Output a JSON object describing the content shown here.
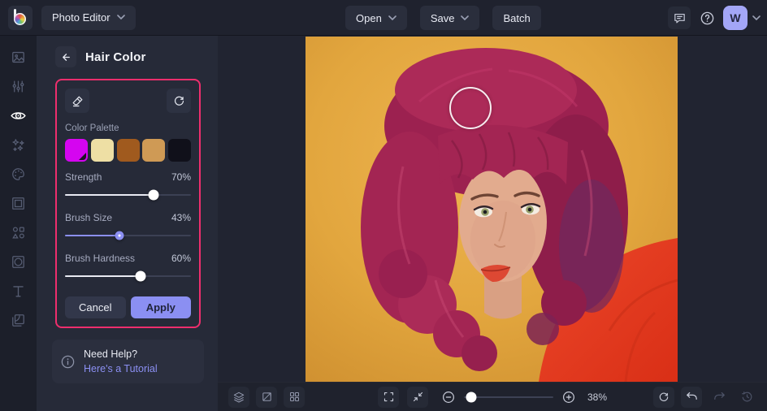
{
  "topbar": {
    "app_menu_label": "Photo Editor",
    "open_label": "Open",
    "save_label": "Save",
    "batch_label": "Batch",
    "avatar_initial": "W"
  },
  "rail": {
    "items": [
      "image-editor",
      "adjust",
      "touch-up",
      "effects",
      "artsy",
      "frames",
      "graphics",
      "overlays",
      "text",
      "textures"
    ],
    "active_item": "touch-up"
  },
  "panel": {
    "title": "Hair Color",
    "palette_label": "Color Palette",
    "swatches": [
      {
        "color": "#d505f0",
        "custom": true
      },
      {
        "color": "#eedfa4",
        "custom": false
      },
      {
        "color": "#a05a1e",
        "custom": false
      },
      {
        "color": "#cf9a55",
        "custom": false
      },
      {
        "color": "#10101a",
        "custom": false
      }
    ],
    "sliders": [
      {
        "label": "Strength",
        "value": "70%",
        "percent": 70,
        "active": false
      },
      {
        "label": "Brush Size",
        "value": "43%",
        "percent": 43,
        "active": true
      },
      {
        "label": "Brush Hardness",
        "value": "60%",
        "percent": 60,
        "active": false
      }
    ],
    "cancel_label": "Cancel",
    "apply_label": "Apply",
    "help_title": "Need Help?",
    "help_link": "Here's a Tutorial"
  },
  "statusbar": {
    "zoom_label": "38%",
    "zoom_slider_percent": 8
  },
  "colors": {
    "accent": "#8b8ff2",
    "highlight_border": "#ee2e6d",
    "avatar_bg": "#a3a6f7",
    "link": "#8b8ff2"
  }
}
